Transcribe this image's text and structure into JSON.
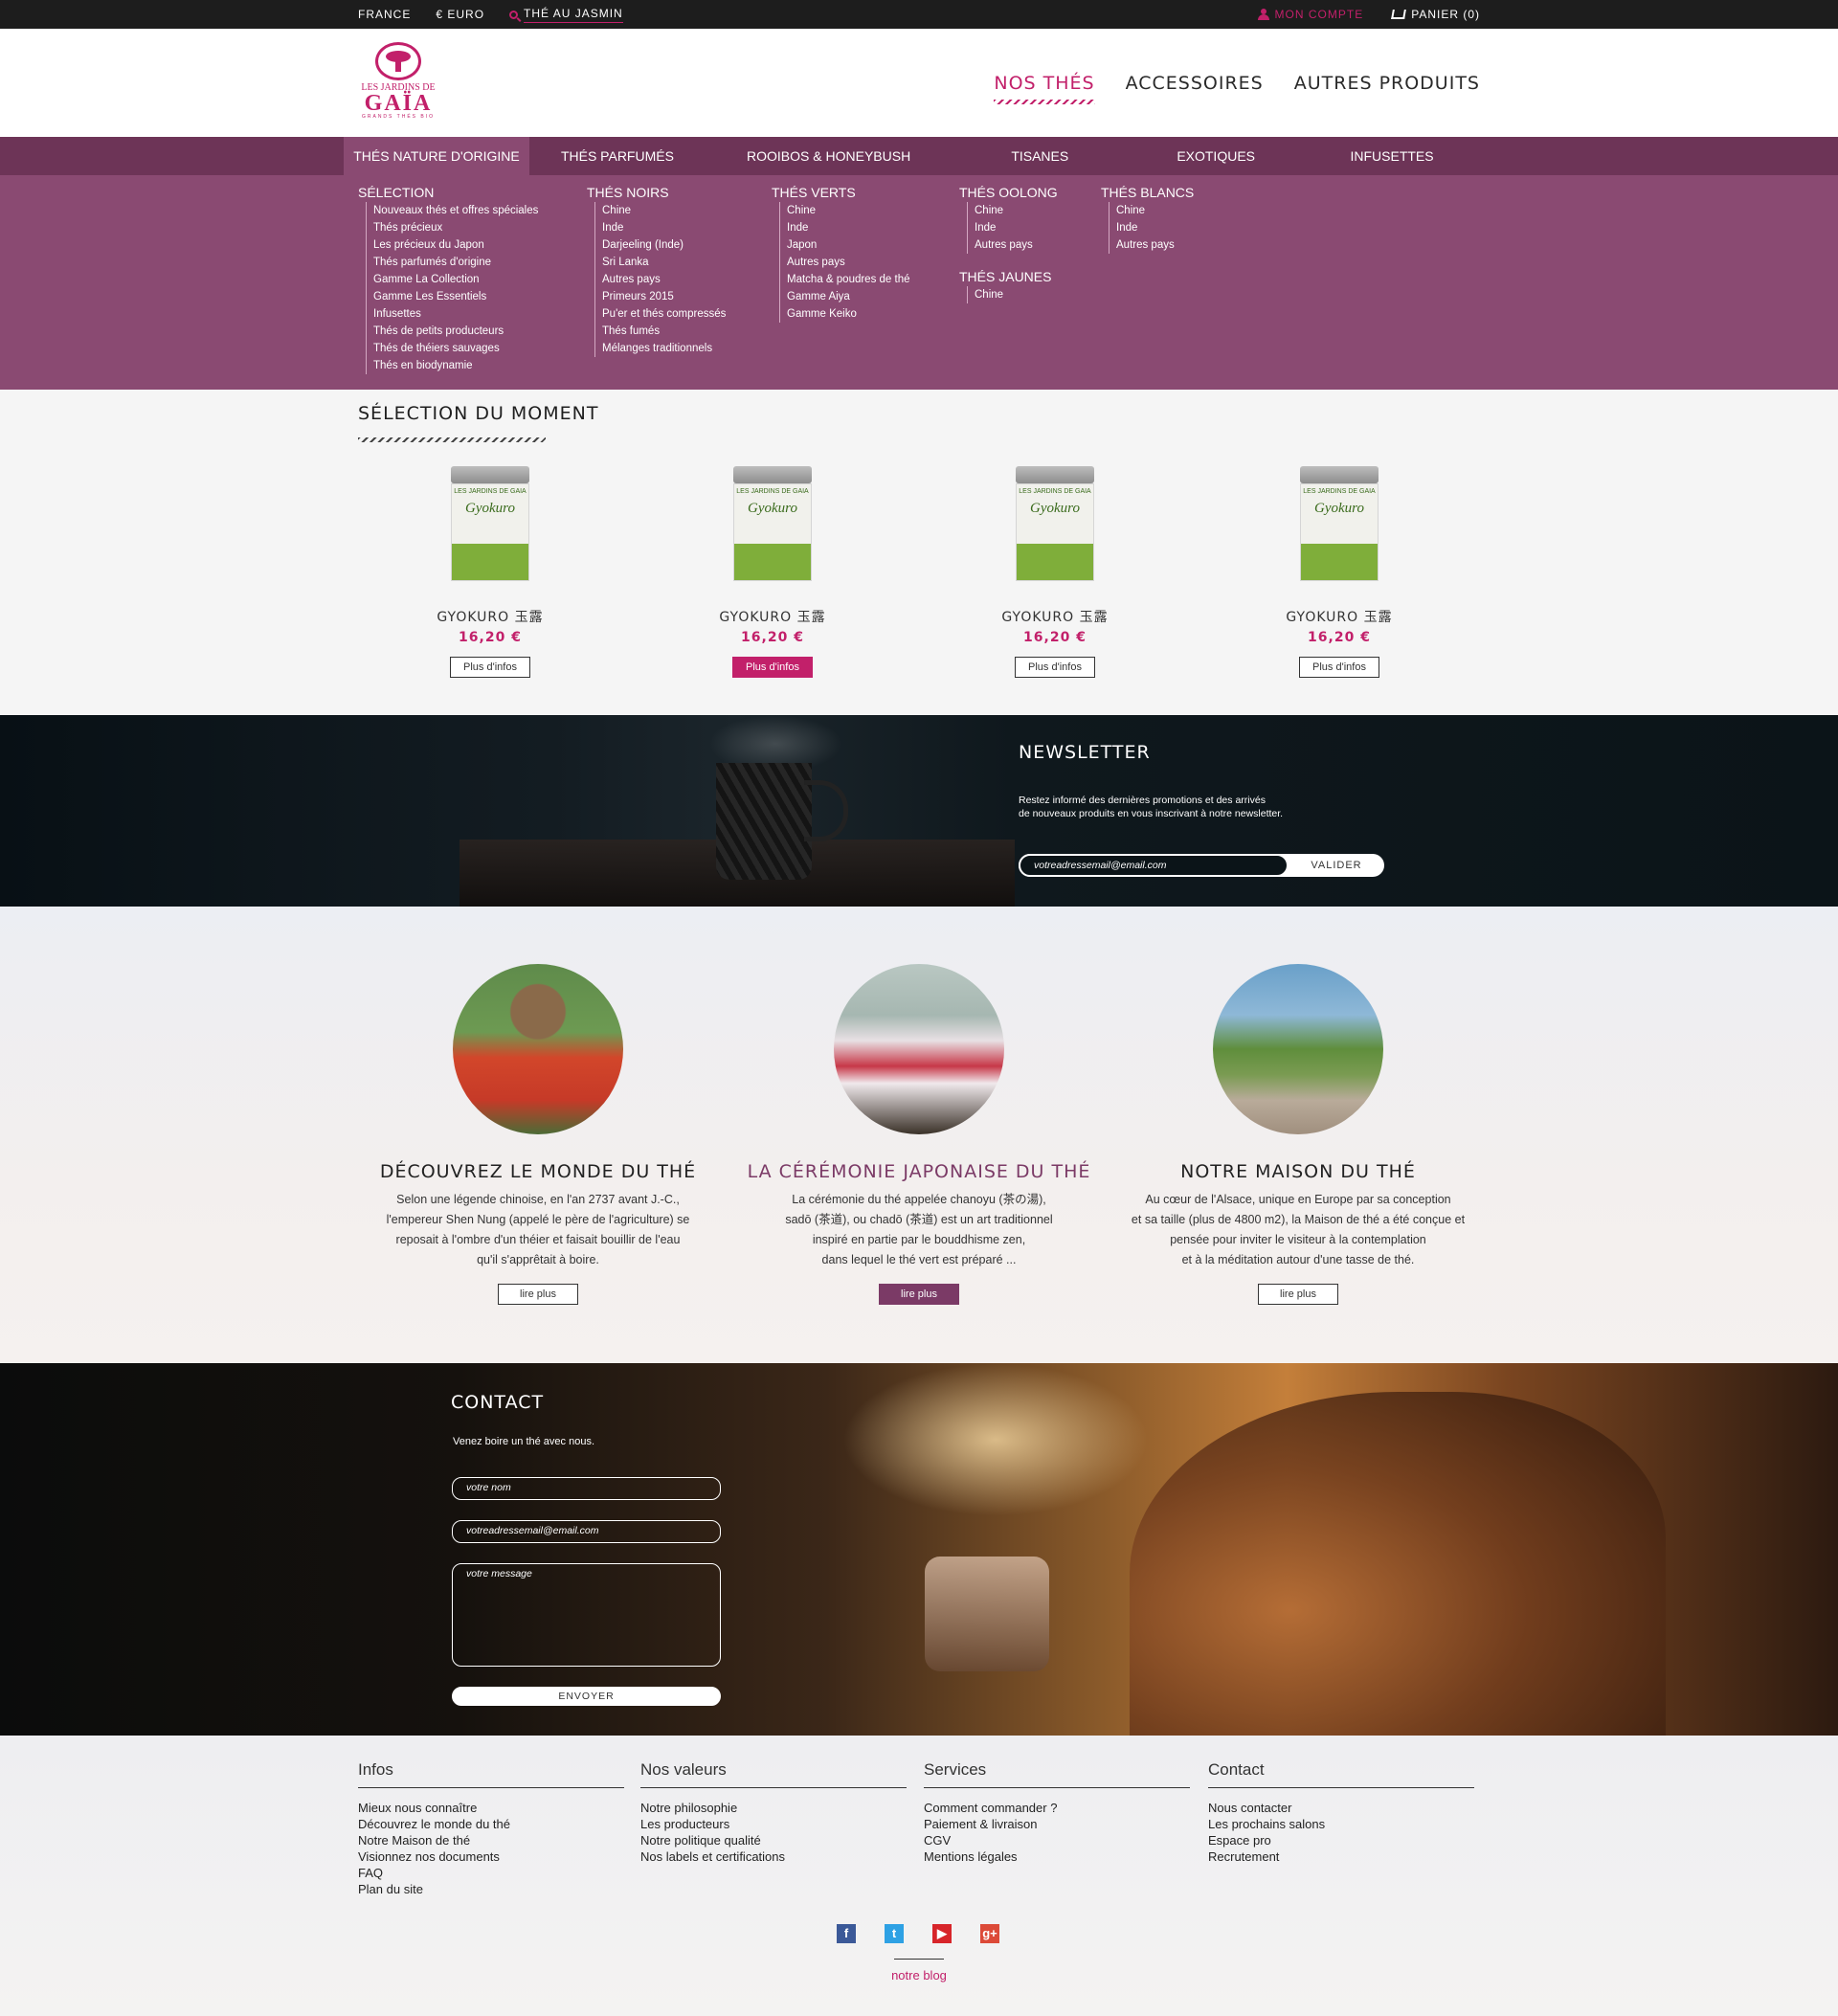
{
  "topbar": {
    "country": "FRANCE",
    "currency": "€ EURO",
    "search_query": "THÉ AU JASMIN",
    "account": "MON COMPTE",
    "cart": "PANIER (0)"
  },
  "logo": {
    "line1": "LES JARDINS DE",
    "line2": "GAÏA",
    "line3": "GRANDS THÉS BIO"
  },
  "main_nav": [
    {
      "label": "NOS THÉS",
      "active": true
    },
    {
      "label": "ACCESSOIRES",
      "active": false
    },
    {
      "label": "AUTRES PRODUITS",
      "active": false
    }
  ],
  "categories": [
    {
      "label": "THÉS NATURE D'ORIGINE",
      "active": true
    },
    {
      "label": "THÉS PARFUMÉS"
    },
    {
      "label": "ROOIBOS & HONEYBUSH"
    },
    {
      "label": "TISANES"
    },
    {
      "label": "EXOTIQUES"
    },
    {
      "label": "INFUSETTES"
    }
  ],
  "dropdown": {
    "selection": {
      "title": "SÉLECTION",
      "items": [
        "Nouveaux thés et offres spéciales",
        "Thés précieux",
        "Les précieux du Japon",
        "Thés parfumés d'origine",
        "Gamme La Collection",
        "Gamme Les Essentiels",
        "Infusettes",
        "Thés de petits producteurs",
        "Thés de théiers sauvages",
        "Thés en biodynamie"
      ]
    },
    "noirs": {
      "title": "THÉS NOIRS",
      "items": [
        "Chine",
        "Inde",
        "Darjeeling (Inde)",
        "Sri Lanka",
        "Autres pays",
        "Primeurs 2015",
        "Pu'er et thés compressés",
        "Thés fumés",
        "Mélanges traditionnels"
      ]
    },
    "verts": {
      "title": "THÉS VERTS",
      "items": [
        "Chine",
        "Inde",
        "Japon",
        "Autres pays",
        "Matcha & poudres de thé",
        "Gamme Aiya",
        "Gamme Keiko"
      ]
    },
    "oolong": {
      "title": "THÉS OOLONG",
      "items": [
        "Chine",
        "Inde",
        "Autres pays"
      ]
    },
    "jaunes": {
      "title": "THÉS JAUNES",
      "items": [
        "Chine"
      ]
    },
    "blancs": {
      "title": "THÉS BLANCS",
      "items": [
        "Chine",
        "Inde",
        "Autres pays"
      ]
    }
  },
  "selection": {
    "title": "SÉLECTION DU MOMENT",
    "products": [
      {
        "name": "GYOKURO 玉露",
        "price": "16,20 €",
        "button": "Plus d'infos",
        "tin_brand": "LES JARDINS DE GAIA",
        "tin_name": "Gyokuro"
      },
      {
        "name": "GYOKURO 玉露",
        "price": "16,20 €",
        "button": "Plus d'infos",
        "tin_brand": "LES JARDINS DE GAIA",
        "tin_name": "Gyokuro"
      },
      {
        "name": "GYOKURO 玉露",
        "price": "16,20 €",
        "button": "Plus d'infos",
        "tin_brand": "LES JARDINS DE GAIA",
        "tin_name": "Gyokuro"
      },
      {
        "name": "GYOKURO 玉露",
        "price": "16,20 €",
        "button": "Plus d'infos",
        "tin_brand": "LES JARDINS DE GAIA",
        "tin_name": "Gyokuro"
      }
    ]
  },
  "newsletter": {
    "title": "NEWSLETTER",
    "desc_line1": "Restez informé des dernières promotions et des arrivés",
    "desc_line2": "de nouveaux produits en vous inscrivant à notre newsletter.",
    "placeholder": "votreadressemail@email.com",
    "button": "VALIDER"
  },
  "discover": [
    {
      "title": "DÉCOUVREZ LE MONDE DU THÉ",
      "lines": [
        "Selon une légende chinoise, en l'an 2737 avant J.-C.,",
        "l'empereur Shen Nung (appelé le père de l'agriculture) se",
        "reposait à l'ombre d'un théier et faisait bouillir de l'eau",
        "qu'il s'apprêtait à boire."
      ],
      "button": "lire plus"
    },
    {
      "title": "LA CÉRÉMONIE JAPONAISE DU THÉ",
      "lines": [
        "La cérémonie du thé appelée chanoyu (茶の湯),",
        "sadō (茶道), ou chadō (茶道) est un art traditionnel",
        "inspiré en partie par le bouddhisme zen,",
        "dans lequel le thé vert est préparé ..."
      ],
      "button": "lire plus"
    },
    {
      "title": "NOTRE MAISON DU THÉ",
      "lines": [
        "Au cœur de l'Alsace, unique en Europe par sa conception",
        "et sa taille (plus de 4800 m2), la Maison de thé a été conçue et",
        "pensée pour inviter le visiteur à la contemplation",
        "et à la méditation autour d'une tasse de thé."
      ],
      "button": "lire plus"
    }
  ],
  "contact": {
    "title": "CONTACT",
    "subtitle": "Venez boire un thé avec nous.",
    "name_placeholder": "votre nom",
    "email_placeholder": "votreadressemail@email.com",
    "message_placeholder": "votre message",
    "button": "ENVOYER"
  },
  "footer": {
    "columns": [
      {
        "title": "Infos",
        "items": [
          "Mieux nous connaître",
          "Découvrez le monde du thé",
          "Notre Maison de thé",
          "Visionnez nos documents",
          "FAQ",
          "Plan du site"
        ]
      },
      {
        "title": "Nos valeurs",
        "items": [
          "Notre philosophie",
          "Les producteurs",
          "Notre politique qualité",
          "Nos labels et certifications"
        ]
      },
      {
        "title": "Services",
        "items": [
          "Comment commander ?",
          "Paiement & livraison",
          "CGV",
          "Mentions légales"
        ]
      },
      {
        "title": "Contact",
        "items": [
          "Nous contacter",
          "Les prochains salons",
          "Espace pro",
          "Recrutement"
        ]
      }
    ],
    "socials": [
      {
        "icon": "facebook-icon",
        "glyph": "f"
      },
      {
        "icon": "twitter-icon",
        "glyph": "t"
      },
      {
        "icon": "youtube-icon",
        "glyph": "▶"
      },
      {
        "icon": "google-plus-icon",
        "glyph": "g+"
      }
    ],
    "blog": "notre blog"
  },
  "colors": {
    "brand_pink": "#c2206a",
    "menu_plum": "#6d3457",
    "dropdown_plum": "#8a4a72",
    "topbar": "#1d1d1d"
  }
}
